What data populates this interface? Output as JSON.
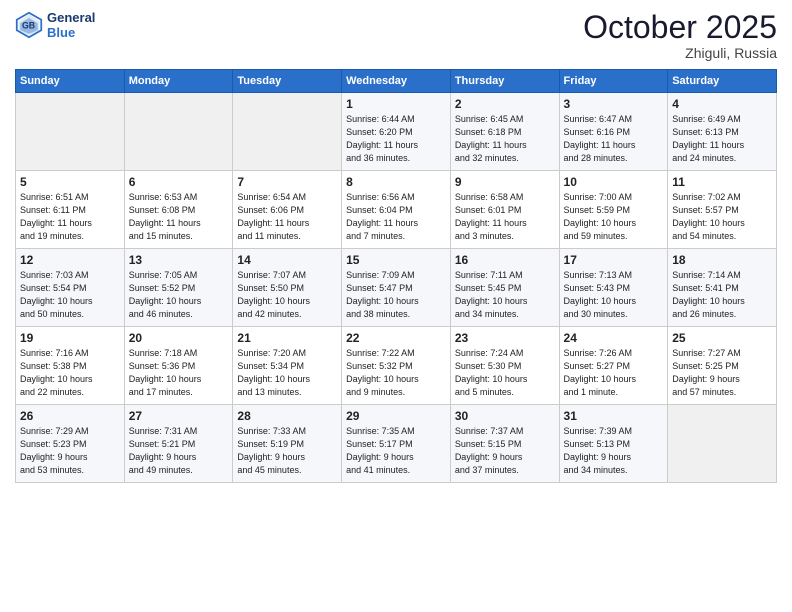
{
  "header": {
    "logo_line1": "General",
    "logo_line2": "Blue",
    "month": "October 2025",
    "location": "Zhiguli, Russia"
  },
  "days_of_week": [
    "Sunday",
    "Monday",
    "Tuesday",
    "Wednesday",
    "Thursday",
    "Friday",
    "Saturday"
  ],
  "weeks": [
    [
      {
        "num": "",
        "info": ""
      },
      {
        "num": "",
        "info": ""
      },
      {
        "num": "",
        "info": ""
      },
      {
        "num": "1",
        "info": "Sunrise: 6:44 AM\nSunset: 6:20 PM\nDaylight: 11 hours\nand 36 minutes."
      },
      {
        "num": "2",
        "info": "Sunrise: 6:45 AM\nSunset: 6:18 PM\nDaylight: 11 hours\nand 32 minutes."
      },
      {
        "num": "3",
        "info": "Sunrise: 6:47 AM\nSunset: 6:16 PM\nDaylight: 11 hours\nand 28 minutes."
      },
      {
        "num": "4",
        "info": "Sunrise: 6:49 AM\nSunset: 6:13 PM\nDaylight: 11 hours\nand 24 minutes."
      }
    ],
    [
      {
        "num": "5",
        "info": "Sunrise: 6:51 AM\nSunset: 6:11 PM\nDaylight: 11 hours\nand 19 minutes."
      },
      {
        "num": "6",
        "info": "Sunrise: 6:53 AM\nSunset: 6:08 PM\nDaylight: 11 hours\nand 15 minutes."
      },
      {
        "num": "7",
        "info": "Sunrise: 6:54 AM\nSunset: 6:06 PM\nDaylight: 11 hours\nand 11 minutes."
      },
      {
        "num": "8",
        "info": "Sunrise: 6:56 AM\nSunset: 6:04 PM\nDaylight: 11 hours\nand 7 minutes."
      },
      {
        "num": "9",
        "info": "Sunrise: 6:58 AM\nSunset: 6:01 PM\nDaylight: 11 hours\nand 3 minutes."
      },
      {
        "num": "10",
        "info": "Sunrise: 7:00 AM\nSunset: 5:59 PM\nDaylight: 10 hours\nand 59 minutes."
      },
      {
        "num": "11",
        "info": "Sunrise: 7:02 AM\nSunset: 5:57 PM\nDaylight: 10 hours\nand 54 minutes."
      }
    ],
    [
      {
        "num": "12",
        "info": "Sunrise: 7:03 AM\nSunset: 5:54 PM\nDaylight: 10 hours\nand 50 minutes."
      },
      {
        "num": "13",
        "info": "Sunrise: 7:05 AM\nSunset: 5:52 PM\nDaylight: 10 hours\nand 46 minutes."
      },
      {
        "num": "14",
        "info": "Sunrise: 7:07 AM\nSunset: 5:50 PM\nDaylight: 10 hours\nand 42 minutes."
      },
      {
        "num": "15",
        "info": "Sunrise: 7:09 AM\nSunset: 5:47 PM\nDaylight: 10 hours\nand 38 minutes."
      },
      {
        "num": "16",
        "info": "Sunrise: 7:11 AM\nSunset: 5:45 PM\nDaylight: 10 hours\nand 34 minutes."
      },
      {
        "num": "17",
        "info": "Sunrise: 7:13 AM\nSunset: 5:43 PM\nDaylight: 10 hours\nand 30 minutes."
      },
      {
        "num": "18",
        "info": "Sunrise: 7:14 AM\nSunset: 5:41 PM\nDaylight: 10 hours\nand 26 minutes."
      }
    ],
    [
      {
        "num": "19",
        "info": "Sunrise: 7:16 AM\nSunset: 5:38 PM\nDaylight: 10 hours\nand 22 minutes."
      },
      {
        "num": "20",
        "info": "Sunrise: 7:18 AM\nSunset: 5:36 PM\nDaylight: 10 hours\nand 17 minutes."
      },
      {
        "num": "21",
        "info": "Sunrise: 7:20 AM\nSunset: 5:34 PM\nDaylight: 10 hours\nand 13 minutes."
      },
      {
        "num": "22",
        "info": "Sunrise: 7:22 AM\nSunset: 5:32 PM\nDaylight: 10 hours\nand 9 minutes."
      },
      {
        "num": "23",
        "info": "Sunrise: 7:24 AM\nSunset: 5:30 PM\nDaylight: 10 hours\nand 5 minutes."
      },
      {
        "num": "24",
        "info": "Sunrise: 7:26 AM\nSunset: 5:27 PM\nDaylight: 10 hours\nand 1 minute."
      },
      {
        "num": "25",
        "info": "Sunrise: 7:27 AM\nSunset: 5:25 PM\nDaylight: 9 hours\nand 57 minutes."
      }
    ],
    [
      {
        "num": "26",
        "info": "Sunrise: 7:29 AM\nSunset: 5:23 PM\nDaylight: 9 hours\nand 53 minutes."
      },
      {
        "num": "27",
        "info": "Sunrise: 7:31 AM\nSunset: 5:21 PM\nDaylight: 9 hours\nand 49 minutes."
      },
      {
        "num": "28",
        "info": "Sunrise: 7:33 AM\nSunset: 5:19 PM\nDaylight: 9 hours\nand 45 minutes."
      },
      {
        "num": "29",
        "info": "Sunrise: 7:35 AM\nSunset: 5:17 PM\nDaylight: 9 hours\nand 41 minutes."
      },
      {
        "num": "30",
        "info": "Sunrise: 7:37 AM\nSunset: 5:15 PM\nDaylight: 9 hours\nand 37 minutes."
      },
      {
        "num": "31",
        "info": "Sunrise: 7:39 AM\nSunset: 5:13 PM\nDaylight: 9 hours\nand 34 minutes."
      },
      {
        "num": "",
        "info": ""
      }
    ]
  ]
}
